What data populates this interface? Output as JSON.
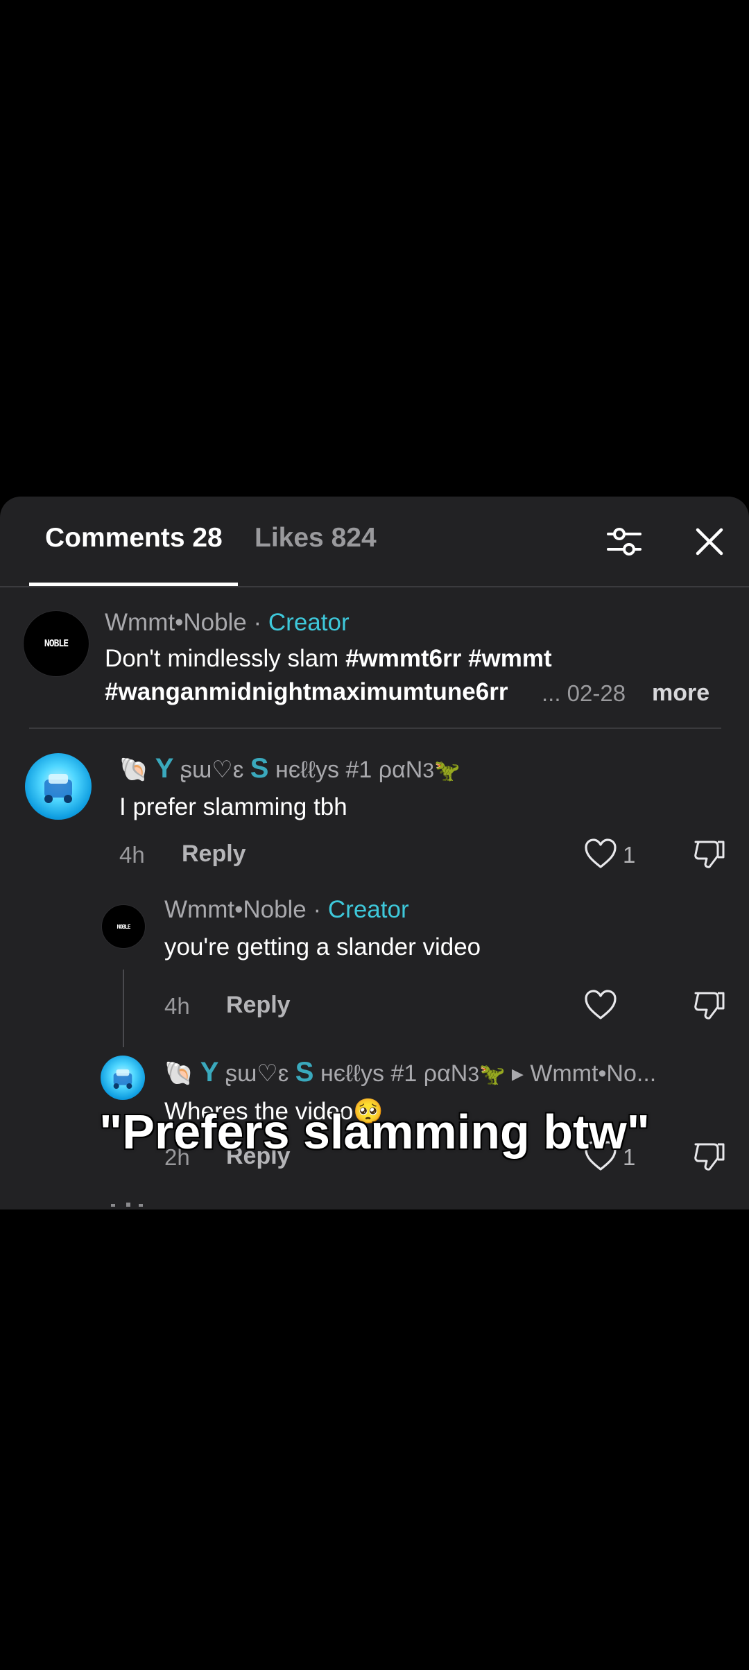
{
  "header": {
    "tab_comments": "Comments 28",
    "tab_likes": "Likes 824",
    "filter_icon": "filter-sliders-icon",
    "close_icon": "close-icon"
  },
  "comments": [
    {
      "user": "Wmmt•Noble",
      "separator": "·",
      "badge": "Creator",
      "text_plain": "Don't mindlessly slam ",
      "hashtag1": "#wmmt6rr",
      "hashtag2": "#wmmt",
      "hashtag3": "#wanganmidnightmaximumtune6rr",
      "ellipsis_date": "... 02-28",
      "more": "more",
      "avatar_text": "NOBLE"
    },
    {
      "user_prefix": "🐚",
      "user_y": "Y",
      "user_part1": "ʂɯ♡ɛ",
      "user_s": "S",
      "user_part2": "нєℓℓуѕ #1 ραΝ",
      "user_suffix": "3🦖",
      "text": "I prefer slamming tbh",
      "time": "4h",
      "reply": "Reply",
      "likes": "1"
    },
    {
      "user": "Wmmt•Noble",
      "separator": "·",
      "badge": "Creator",
      "text": "you're getting a slander video",
      "time": "4h",
      "reply": "Reply",
      "avatar_text": "NOBLE"
    },
    {
      "user_prefix": "🐚",
      "user_y": "Y",
      "user_part1": "ʂɯ♡ɛ",
      "user_s": "S",
      "user_part2": "нєℓℓуѕ #1 ραΝ",
      "user_suffix": "3🦖",
      "arrow": "▸",
      "reply_to": "Wmmt•No...",
      "text": "Wheres the video🥺",
      "time": "2h",
      "reply": "Reply",
      "likes": "1"
    }
  ],
  "overlay": {
    "caption": "\"Prefers slamming btw\""
  }
}
